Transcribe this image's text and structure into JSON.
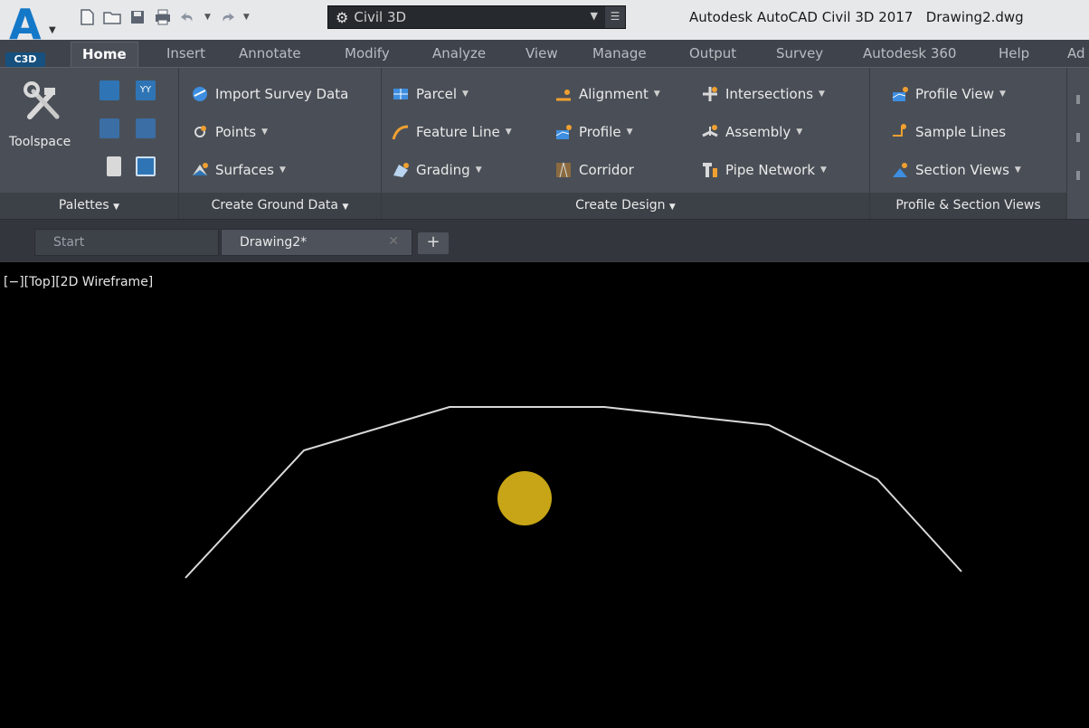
{
  "titlebar": {
    "app_badge": "C3D",
    "workspace": "Civil 3D",
    "title": "Autodesk AutoCAD Civil 3D 2017",
    "filename": "Drawing2.dwg"
  },
  "ribbon_tabs": [
    "Home",
    "Insert",
    "Annotate",
    "Modify",
    "Analyze",
    "View",
    "Manage",
    "Output",
    "Survey",
    "Autodesk 360",
    "Help",
    "Ad"
  ],
  "active_tab": "Home",
  "panels": {
    "palettes": {
      "title": "Palettes",
      "toolspace": "Toolspace"
    },
    "ground": {
      "title": "Create Ground Data",
      "import_survey": "Import Survey Data",
      "points": "Points",
      "surfaces": "Surfaces"
    },
    "design": {
      "title": "Create Design",
      "parcel": "Parcel",
      "feature_line": "Feature Line",
      "grading": "Grading",
      "alignment": "Alignment",
      "profile": "Profile",
      "corridor": "Corridor",
      "intersections": "Intersections",
      "assembly": "Assembly",
      "pipe_network": "Pipe Network"
    },
    "profile_section": {
      "title": "Profile & Section Views",
      "profile_view": "Profile View",
      "sample_lines": "Sample Lines",
      "section_views": "Section Views"
    }
  },
  "doc_tabs": {
    "start": "Start",
    "drawing": "Drawing2*",
    "new_tab": "+"
  },
  "viewport": {
    "label": "[−][Top][2D Wireframe]",
    "line_color": "#d9d9d9",
    "point_color": "#c7a516"
  },
  "colors": {
    "accent": "#1478c8",
    "ribbon_bg": "#4a4f57",
    "tabs_bg": "#3f444c"
  }
}
